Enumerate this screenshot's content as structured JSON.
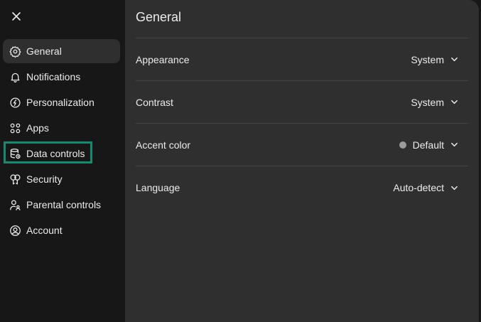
{
  "colors": {
    "sidebar_bg": "#171717",
    "panel_bg": "#2f2f2f",
    "active_item_bg": "#2f2f2f",
    "highlight_border": "#138a72",
    "accent_dot": "#9b9b9b",
    "text": "#ececec"
  },
  "sidebar": {
    "close_icon": "close-icon",
    "items": [
      {
        "id": "general",
        "label": "General",
        "icon": "gear-icon",
        "active": true
      },
      {
        "id": "notifications",
        "label": "Notifications",
        "icon": "bell-icon"
      },
      {
        "id": "personalization",
        "label": "Personalization",
        "icon": "personalization-icon"
      },
      {
        "id": "apps",
        "label": "Apps",
        "icon": "apps-grid-icon"
      },
      {
        "id": "data-controls",
        "label": "Data controls",
        "icon": "database-icon",
        "highlighted": true
      },
      {
        "id": "security",
        "label": "Security",
        "icon": "key-icon"
      },
      {
        "id": "parental-controls",
        "label": "Parental controls",
        "icon": "parental-icon"
      },
      {
        "id": "account",
        "label": "Account",
        "icon": "account-icon"
      }
    ]
  },
  "main": {
    "title": "General",
    "settings": [
      {
        "label": "Appearance",
        "value": "System"
      },
      {
        "label": "Contrast",
        "value": "System"
      },
      {
        "label": "Accent color",
        "value": "Default",
        "dot_color": "#9b9b9b"
      },
      {
        "label": "Language",
        "value": "Auto-detect"
      }
    ]
  }
}
